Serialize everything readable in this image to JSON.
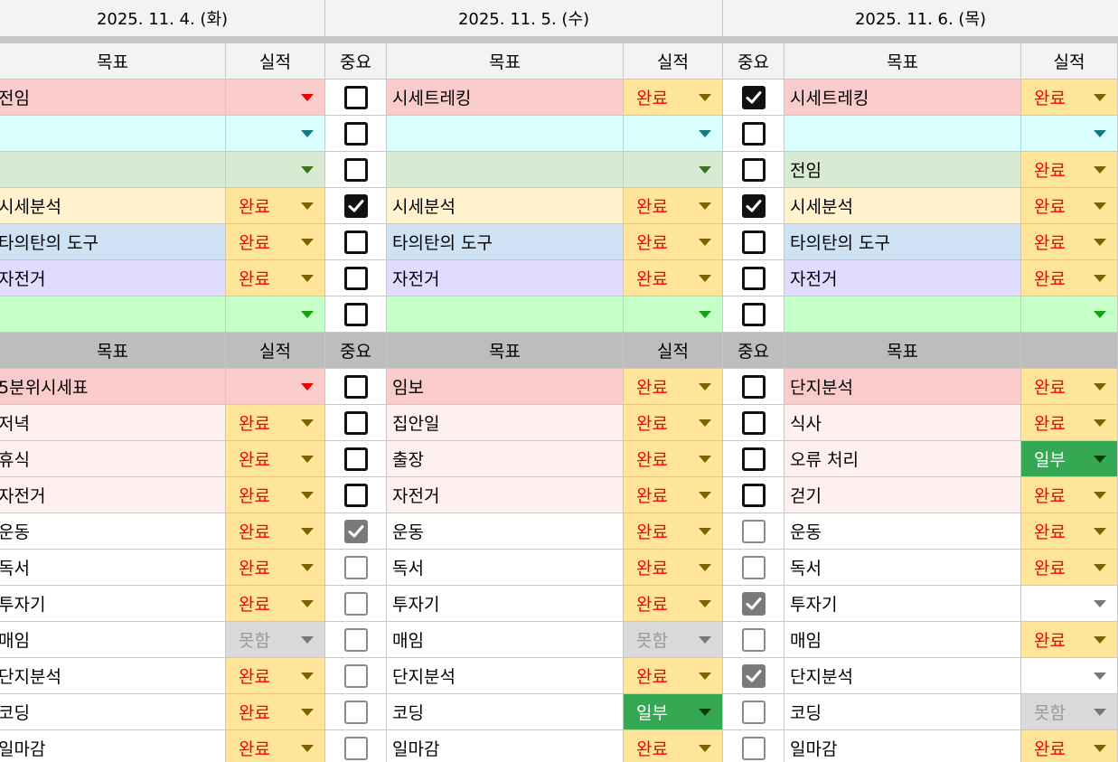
{
  "dates": [
    "2025. 11. 4. (화)",
    "2025. 11. 5. (수)",
    "2025. 11. 6. (목)"
  ],
  "header1": {
    "goal": "목표",
    "result": "실적",
    "important": "중요"
  },
  "header2": {
    "goal": "목표",
    "result": "실적",
    "important": "중요",
    "last_result": ""
  },
  "colors": {
    "red": "#f9cbcb",
    "cyan": "#daffff",
    "green": "#d9ead3",
    "yellow": "#fff2cc",
    "blue": "#cfe2f3",
    "purple": "#e0dcfe",
    "mint": "#c7ffc8",
    "pink": "#fff0f0",
    "white": "#ffffff",
    "done_bg": "#ffe599",
    "done_text": "#ff0000",
    "part_bg": "#34a853",
    "part_text": "#ffffff",
    "fail_bg": "#d9d9d9",
    "fail_text": "#999999"
  },
  "section1": [
    {
      "bg": "red",
      "arrow": "#e60000",
      "days": [
        {
          "goal": "전임",
          "res": ""
        },
        {
          "imp": false,
          "goal": "시세트레킹",
          "res": "완료"
        },
        {
          "imp": true,
          "goal": "시세트레킹",
          "res": "완료"
        }
      ]
    },
    {
      "bg": "cyan",
      "arrow": "#137a7f",
      "days": [
        {
          "goal": "",
          "res": ""
        },
        {
          "imp": false,
          "goal": "",
          "res": ""
        },
        {
          "imp": false,
          "goal": "",
          "res": ""
        }
      ]
    },
    {
      "bg": "green",
      "arrow": "#38761d",
      "days": [
        {
          "goal": "",
          "res": ""
        },
        {
          "imp": false,
          "goal": "",
          "res": ""
        },
        {
          "imp": false,
          "goal": "전임",
          "res": "완료"
        }
      ]
    },
    {
      "bg": "yellow",
      "arrow": "#bf9000",
      "days": [
        {
          "goal": "시세분석",
          "res": "완료"
        },
        {
          "imp": true,
          "goal": "시세분석",
          "res": "완료"
        },
        {
          "imp": true,
          "goal": "시세분석",
          "res": "완료"
        }
      ]
    },
    {
      "bg": "blue",
      "arrow": "#0b5394",
      "days": [
        {
          "goal": "타의탄의 도구",
          "res": "완료"
        },
        {
          "imp": false,
          "goal": "타의탄의 도구",
          "res": "완료"
        },
        {
          "imp": false,
          "goal": "타의탄의 도구",
          "res": "완료"
        }
      ]
    },
    {
      "bg": "purple",
      "arrow": "#5b3fb3",
      "days": [
        {
          "goal": "자전거",
          "res": "완료"
        },
        {
          "imp": false,
          "goal": "자전거",
          "res": "완료"
        },
        {
          "imp": false,
          "goal": "자전거",
          "res": "완료"
        }
      ]
    },
    {
      "bg": "mint",
      "arrow": "#11a411",
      "days": [
        {
          "goal": "",
          "res": ""
        },
        {
          "imp": false,
          "goal": "",
          "res": ""
        },
        {
          "imp": false,
          "goal": "",
          "res": ""
        }
      ]
    }
  ],
  "section2": [
    {
      "bg": "red",
      "arrow": "#e60000",
      "grey": false,
      "days": [
        {
          "goal": "5분위시세표",
          "res": ""
        },
        {
          "imp": false,
          "goal": "임보",
          "res": "완료"
        },
        {
          "imp": false,
          "goal": "단지분석",
          "res": "완료"
        }
      ]
    },
    {
      "bg": "pink",
      "arrow": "#777777",
      "grey": false,
      "days": [
        {
          "goal": "저녁",
          "res": "완료"
        },
        {
          "imp": false,
          "goal": "집안일",
          "res": "완료"
        },
        {
          "imp": false,
          "goal": "식사",
          "res": "완료"
        }
      ]
    },
    {
      "bg": "pink",
      "arrow": "#777777",
      "grey": false,
      "days": [
        {
          "goal": "휴식",
          "res": "완료"
        },
        {
          "imp": false,
          "goal": "출장",
          "res": "완료"
        },
        {
          "imp": false,
          "goal": "오류 처리",
          "res": "일부"
        }
      ]
    },
    {
      "bg": "pink",
      "arrow": "#777777",
      "grey": false,
      "days": [
        {
          "goal": "자전거",
          "res": "완료"
        },
        {
          "imp": false,
          "goal": "자전거",
          "res": "완료"
        },
        {
          "imp": false,
          "goal": "걷기",
          "res": "완료"
        }
      ]
    },
    {
      "bg": "white",
      "arrow": "#777777",
      "grey": true,
      "days": [
        {
          "goal": "운동",
          "res": "완료"
        },
        {
          "imp": true,
          "goal": "운동",
          "res": "완료"
        },
        {
          "imp": false,
          "goal": "운동",
          "res": "완료"
        }
      ]
    },
    {
      "bg": "white",
      "arrow": "#777777",
      "grey": true,
      "days": [
        {
          "goal": "독서",
          "res": "완료"
        },
        {
          "imp": false,
          "goal": "독서",
          "res": "완료"
        },
        {
          "imp": false,
          "goal": "독서",
          "res": "완료"
        }
      ]
    },
    {
      "bg": "white",
      "arrow": "#777777",
      "grey": true,
      "days": [
        {
          "goal": "투자기",
          "res": "완료"
        },
        {
          "imp": false,
          "goal": "투자기",
          "res": "완료"
        },
        {
          "imp": true,
          "goal": "투자기",
          "res": ""
        }
      ]
    },
    {
      "bg": "white",
      "arrow": "#777777",
      "grey": true,
      "days": [
        {
          "goal": "매임",
          "res": "못함"
        },
        {
          "imp": false,
          "goal": "매임",
          "res": "못함"
        },
        {
          "imp": false,
          "goal": "매임",
          "res": "완료"
        }
      ]
    },
    {
      "bg": "white",
      "arrow": "#777777",
      "grey": true,
      "days": [
        {
          "goal": "단지분석",
          "res": "완료"
        },
        {
          "imp": false,
          "goal": "단지분석",
          "res": "완료"
        },
        {
          "imp": true,
          "goal": "단지분석",
          "res": ""
        }
      ]
    },
    {
      "bg": "white",
      "arrow": "#777777",
      "grey": true,
      "days": [
        {
          "goal": "코딩",
          "res": "완료"
        },
        {
          "imp": false,
          "goal": "코딩",
          "res": "일부"
        },
        {
          "imp": false,
          "goal": "코딩",
          "res": "못함"
        }
      ]
    },
    {
      "bg": "white",
      "arrow": "#777777",
      "grey": true,
      "days": [
        {
          "goal": "일마감",
          "res": "완료"
        },
        {
          "imp": false,
          "goal": "일마감",
          "res": "완료"
        },
        {
          "imp": false,
          "goal": "일마감",
          "res": "완료"
        }
      ]
    }
  ]
}
